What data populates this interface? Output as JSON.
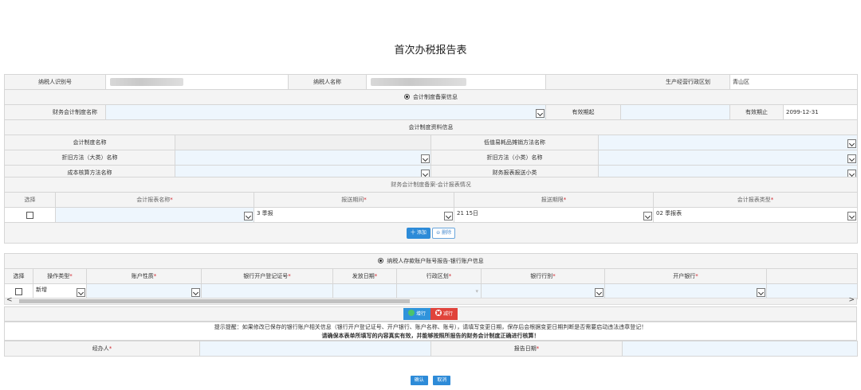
{
  "page_title": "首次办税报告表",
  "top_info": {
    "taxpayer_id_label": "纳税人识别号",
    "taxpayer_name_label": "纳税人名称",
    "region_label": "生产经营行政区划",
    "region_value": "青山区"
  },
  "acct_filing": {
    "section_title": "会计制度备案信息",
    "system_name_label": "财务会计制度名称",
    "valid_from_label": "有效期起",
    "valid_to_label": "有效期止",
    "valid_to_value": "2099-12-31"
  },
  "acct_material": {
    "section_title": "会计制度资料信息",
    "system_name_label": "会计制度名称",
    "low_value_label": "低值易耗品摊销方法名称",
    "dep_large_label": "折旧方法（大类）名称",
    "dep_small_label": "折旧方法（小类）名称",
    "cost_label": "成本核算方法名称",
    "report_sub_label": "财务报表报送小类"
  },
  "report_table": {
    "section_title": "财务会计制度备案-会计报表情况",
    "headers": [
      "选择",
      "会计报表名称",
      "报送期间",
      "报送期限",
      "会计报表类型"
    ],
    "row": {
      "period": "3 季报",
      "deadline": "21 15日",
      "type": "02 季报表"
    },
    "add_button": "十 添加",
    "delete_button": "删除"
  },
  "bank_section": {
    "section_title": "纳税人存款账户账号报告-银行账户信息",
    "headers": [
      "选择",
      "操作类型",
      "账户性质",
      "银行开户登记证号",
      "发放日期",
      "行政区划",
      "银行行别",
      "开户银行"
    ],
    "row": {
      "op_type": "新增"
    },
    "add_row_button": "增行",
    "remove_row_button": "减行"
  },
  "tip": {
    "line1": "提示提醒：如果修改已保存的银行账户相关信息（银行开户登记证号、开户银行、账户名称、账号），请填写变更日期，保存后会根据变更日期判断是否需要启动违法违章登记！",
    "line2": "请确保本表单所填写的内容真实有效，并能够按照所报告的财务会计制度正确进行核算！"
  },
  "footer_fields": {
    "agent_label": "经办人",
    "report_date_label": "报告日期"
  },
  "buttons": {
    "confirm": "确认",
    "cancel": "取消"
  }
}
